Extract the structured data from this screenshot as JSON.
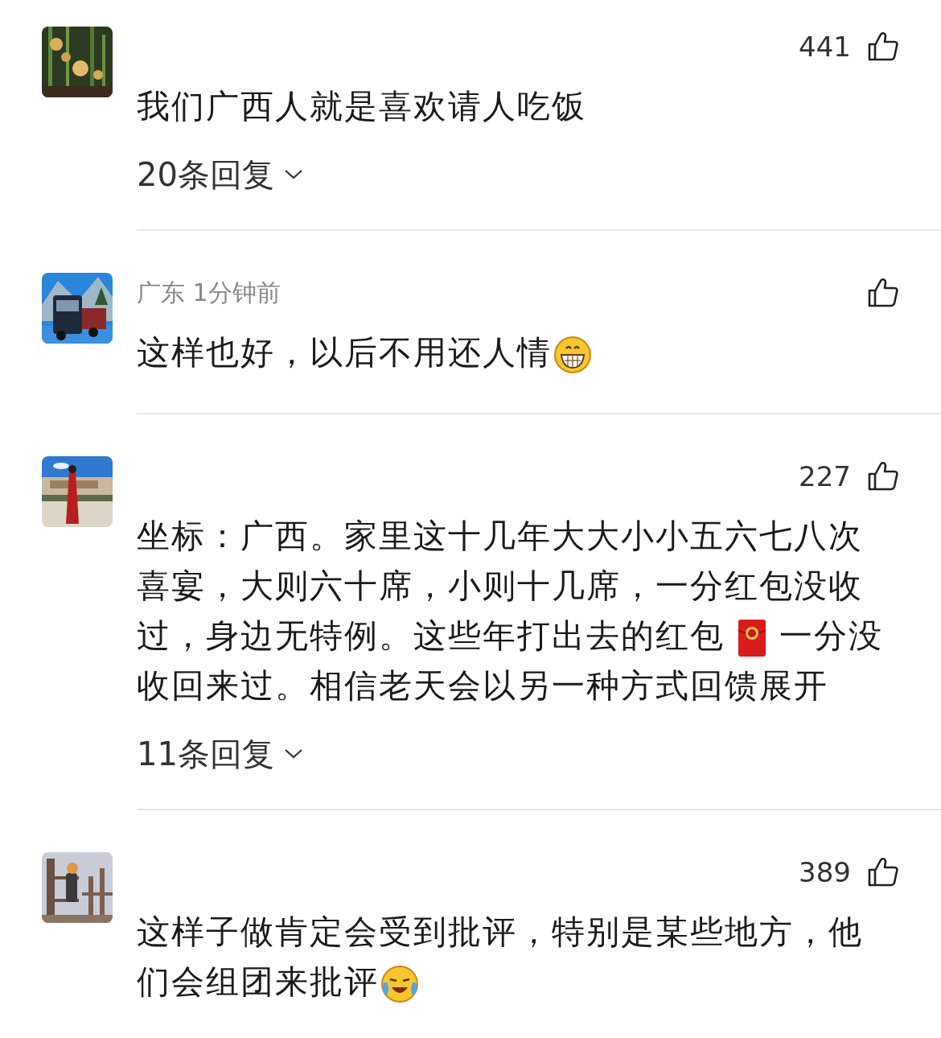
{
  "comments": [
    {
      "likes": "441",
      "body": [
        {
          "kind": "text",
          "text": "我们广西人就是喜欢请人吃饭"
        }
      ],
      "replies": "20条回复"
    },
    {
      "meta": "广东 1分钟前",
      "body": [
        {
          "kind": "text",
          "text": "这样也好，以后不用还人情"
        },
        {
          "kind": "grin-emoji"
        }
      ]
    },
    {
      "likes": "227",
      "body": [
        {
          "kind": "text",
          "text": "坐标：广西。家里这十几年大大小小五六七八次喜宴，大则六十席，小则十几席，一分红包没收过，身边无特例。这些年打出去的红包"
        },
        {
          "kind": "red-packet"
        },
        {
          "kind": "text",
          "text": "一分没收回来过。相信老天会以另一种方式回馈"
        },
        {
          "kind": "link",
          "text": "展开"
        }
      ],
      "replies": "11条回复"
    },
    {
      "likes": "389",
      "body": [
        {
          "kind": "text",
          "text": "这样子做肯定会受到批评，特别是某些地方，他们会组团来批评"
        },
        {
          "kind": "cry-emoji"
        }
      ]
    }
  ]
}
